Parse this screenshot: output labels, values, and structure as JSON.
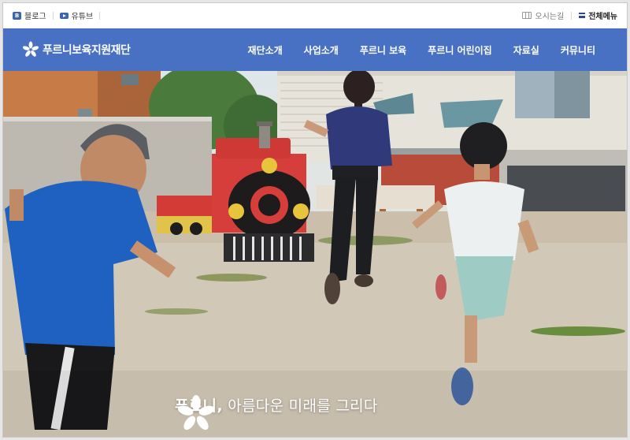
{
  "util": {
    "blog_label": "블로그",
    "youtube_label": "유튜브",
    "directions_label": "오시는길",
    "all_menu_label": "전체메뉴"
  },
  "logo": {
    "text": "푸르니보육지원재단"
  },
  "nav": {
    "items": [
      {
        "label": "재단소개"
      },
      {
        "label": "사업소개"
      },
      {
        "label": "푸르니 보육"
      },
      {
        "label": "푸르니 어린이집"
      },
      {
        "label": "자료실"
      },
      {
        "label": "커뮤니티"
      }
    ]
  },
  "hero": {
    "tagline_brand": "푸르니,",
    "tagline_text": "아름다운 미래를 그리다"
  },
  "colors": {
    "nav_bg": "#4870c3",
    "icon_accent": "#3c64b1"
  }
}
